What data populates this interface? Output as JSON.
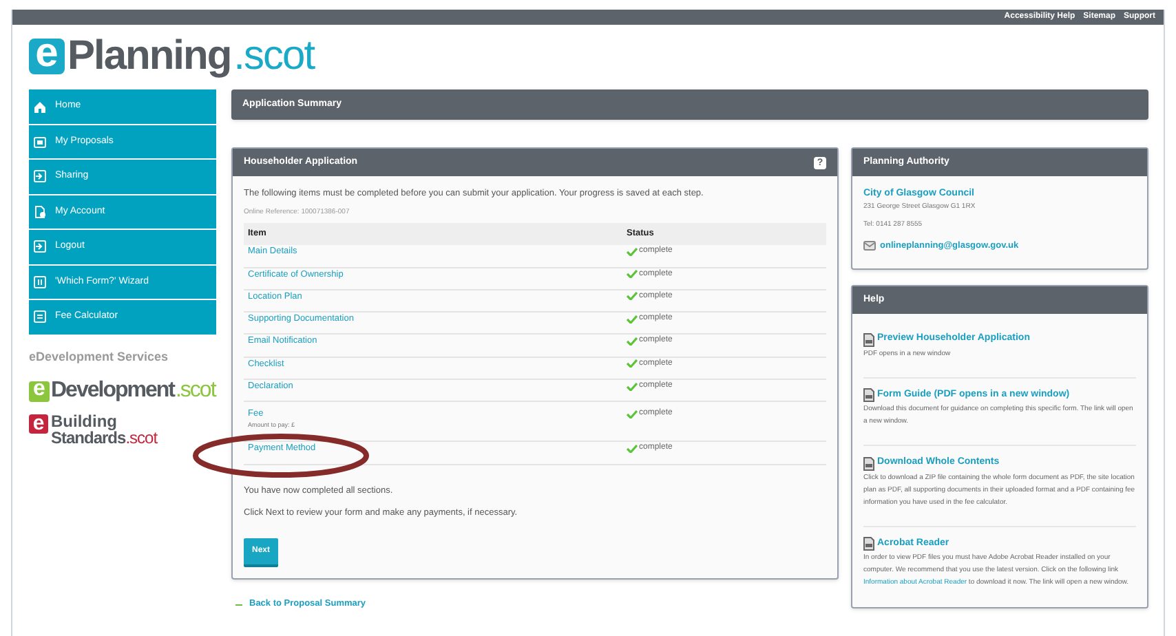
{
  "top_links": [
    "Accessibility Help",
    "Sitemap",
    "Support"
  ],
  "logo": {
    "mark": "e",
    "name": "Planning",
    "suffix": ".scot"
  },
  "nav": [
    {
      "label": "Home"
    },
    {
      "label": "My Proposals"
    },
    {
      "label": "Sharing"
    },
    {
      "label": "My Account"
    },
    {
      "label": "Logout"
    },
    {
      "label": "'Which Form?' Wizard"
    },
    {
      "label": "Fee Calculator"
    }
  ],
  "services": {
    "heading": "eDevelopment Services",
    "edevelopment": {
      "mark": "e",
      "name": "Development",
      "suffix": ".scot"
    },
    "building": {
      "mark": "e",
      "line_1": "Building",
      "line_2": "Standards",
      "suffix": ".scot"
    }
  },
  "summary_title": "Application Summary",
  "application": {
    "title": "Householder Application",
    "help_icon": "?",
    "intro": "The following items must be completed before you can submit your application. Your progress is saved at each step.",
    "reference": "Online Reference: 100071386-007",
    "columns": [
      "Item",
      "Status"
    ],
    "rows": [
      {
        "item": "Main Details",
        "status": "complete"
      },
      {
        "item": "Certificate of Ownership",
        "status": "complete"
      },
      {
        "item": "Location Plan",
        "status": "complete"
      },
      {
        "item": "Supporting Documentation",
        "status": "complete"
      },
      {
        "item": "Email Notification",
        "status": "complete"
      },
      {
        "item": "Checklist",
        "status": "complete"
      },
      {
        "item": "Declaration",
        "status": "complete"
      },
      {
        "item": "Fee",
        "note": "Amount to pay: £",
        "status": "complete"
      },
      {
        "item": "Payment Method",
        "status": "complete"
      }
    ],
    "done_text": "You have now completed all sections.",
    "next_text": "Click Next to review your form and make any payments, if necessary.",
    "next_button": "Next"
  },
  "back_link": "Back to Proposal Summary",
  "authority": {
    "title": "Planning Authority",
    "name": "City of Glasgow Council",
    "address": "231 George Street Glasgow G1 1RX",
    "phone": "Tel: 0141 287 8555",
    "email": "onlineplanning@glasgow.gov.uk"
  },
  "help": {
    "title": "Help",
    "items": [
      {
        "title": "Preview Householder Application",
        "text": "PDF opens in a new window"
      },
      {
        "title": "Form Guide (PDF opens in a new window)",
        "text": "Download this document for guidance on completing this specific form. The link will open a new window."
      },
      {
        "title": "Download Whole Contents",
        "text": "Click to download a ZIP file containing the whole form document as PDF, the site location plan as PDF, all supporting documents in their uploaded format and a PDF containing fee information you have used in the fee calculator."
      },
      {
        "title": "Acrobat Reader",
        "text": "In order to view PDF files you must have Adobe Acrobat Reader installed on your computer. We recommend that you use the latest version. Click on the following link",
        "link": "Information about Acrobat Reader",
        "text_after": "to download it now. The link will open a new window."
      }
    ]
  }
}
